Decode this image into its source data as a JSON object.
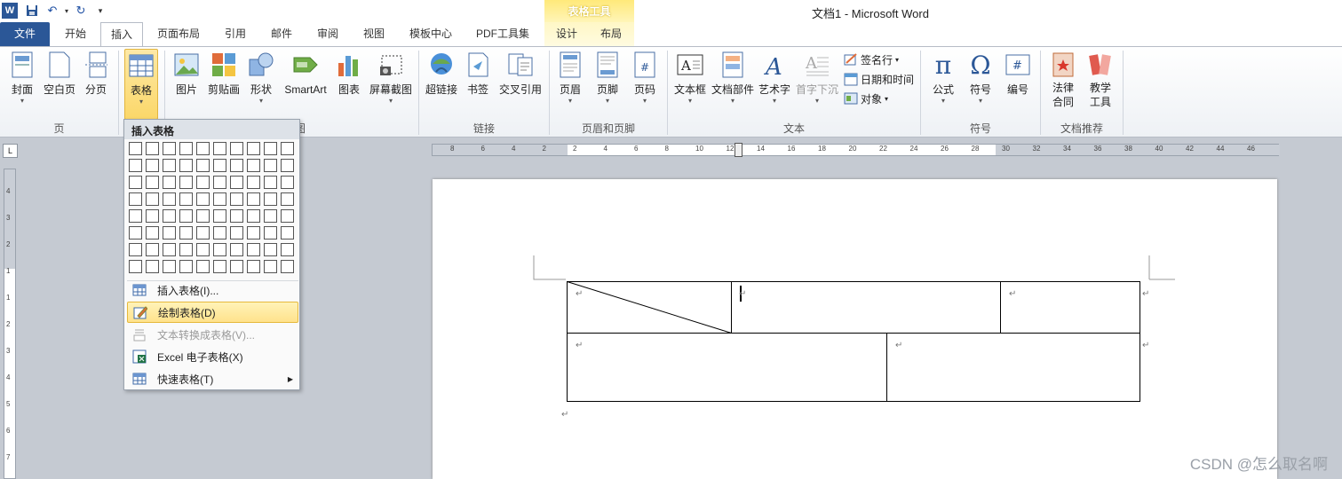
{
  "window": {
    "title": "文档1  -  Microsoft Word",
    "context_tab_header": "表格工具"
  },
  "tabs": [
    "文件",
    "开始",
    "插入",
    "页面布局",
    "引用",
    "邮件",
    "审阅",
    "视图",
    "模板中心",
    "PDF工具集",
    "设计",
    "布局"
  ],
  "ribbon": {
    "pages": {
      "cover": "封面",
      "blank": "空白页",
      "break": "分页",
      "group": "页"
    },
    "tables": {
      "table": "表格"
    },
    "illustrations": {
      "picture": "图片",
      "clipart": "剪贴画",
      "shapes": "形状",
      "smartart": "SmartArt",
      "chart": "图表",
      "screenshot": "屏幕截图"
    },
    "links": {
      "hyperlink": "超链接",
      "bookmark": "书签",
      "crossref": "交叉引用",
      "group": "链接"
    },
    "header_footer": {
      "header": "页眉",
      "footer": "页脚",
      "pagenum": "页码",
      "group": "页眉和页脚"
    },
    "text": {
      "textbox": "文本框",
      "quickparts": "文档部件",
      "wordart": "艺术字",
      "dropcap": "首字下沉",
      "signature": "签名行",
      "datetime": "日期和时间",
      "object": "对象",
      "group": "文本"
    },
    "symbols": {
      "equation": "公式",
      "symbol": "符号",
      "number": "编号",
      "group": "符号"
    },
    "docrec": {
      "law_line1": "法律",
      "law_line2": "合同",
      "teach_line1": "教学",
      "teach_line2": "工具",
      "group": "文档推荐"
    }
  },
  "dropdown": {
    "title": "插入表格",
    "items": [
      {
        "label": "插入表格(I)...",
        "state": "normal"
      },
      {
        "label": "绘制表格(D)",
        "state": "highlighted"
      },
      {
        "label": "文本转换成表格(V)...",
        "state": "disabled"
      },
      {
        "label": "Excel 电子表格(X)",
        "state": "normal"
      },
      {
        "label": "快速表格(T)",
        "state": "normal",
        "submenu": true
      }
    ]
  },
  "hruler_labels": [
    "8",
    "6",
    "4",
    "2",
    "2",
    "4",
    "6",
    "8",
    "10",
    "12",
    "14",
    "16",
    "18",
    "20",
    "22",
    "24",
    "26",
    "28",
    "30",
    "32",
    "34",
    "36",
    "38",
    "40",
    "42",
    "44",
    "46"
  ],
  "vruler_labels": [
    "4",
    "3",
    "2",
    "1",
    "1",
    "2",
    "3",
    "4",
    "5",
    "6",
    "7"
  ],
  "watermark": "CSDN @怎么取名啊",
  "colors": {
    "file_tab": "#2b5797",
    "highlight": "#ffe28c",
    "context_tab": "#ffe97a"
  }
}
